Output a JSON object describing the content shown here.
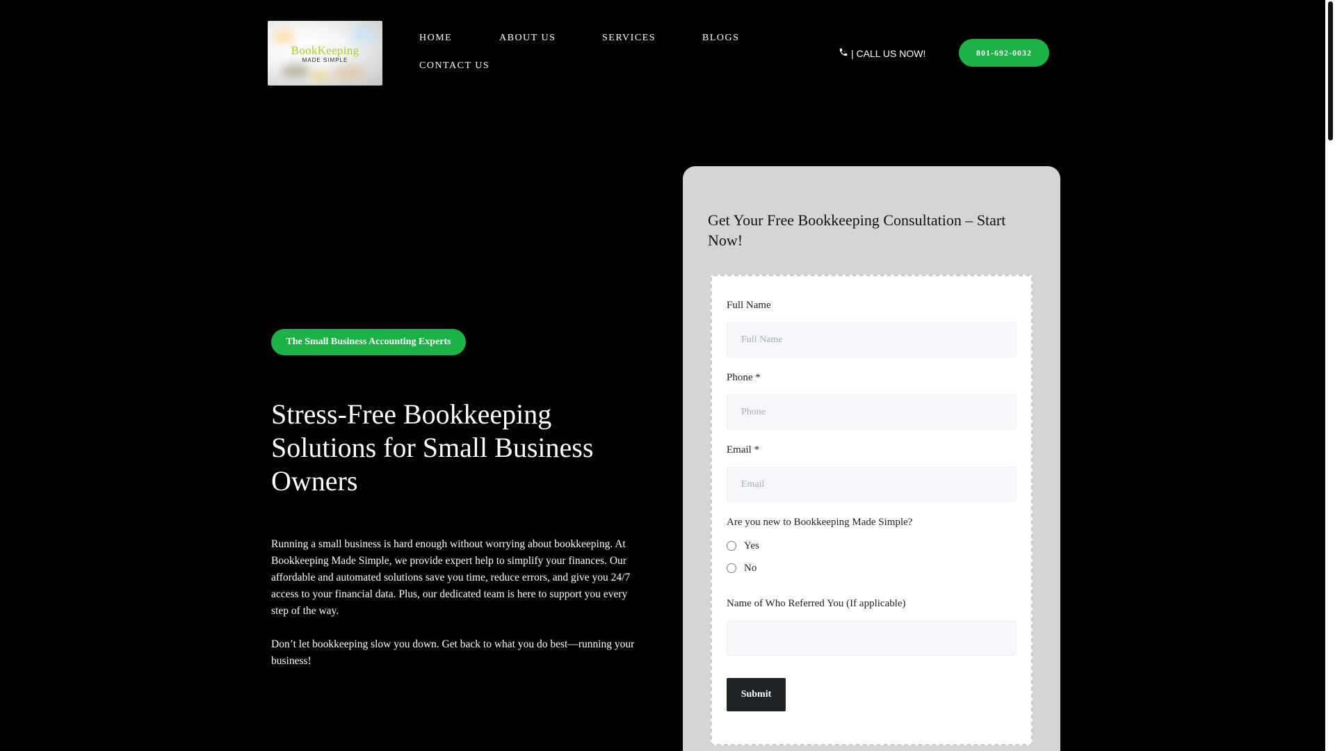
{
  "header": {
    "logo": {
      "title": "BookKeeping",
      "subtitle": "MADE SIMPLE"
    },
    "nav": {
      "home": "HOME",
      "about": "ABOUT US",
      "services": "SERVICES",
      "blogs": "BLOGS",
      "contact": "CONTACT US"
    },
    "call_text": "| CALL US NOW!",
    "phone_button": "801-692-0032"
  },
  "hero": {
    "badge": "The Small Business Accounting Experts",
    "title": "Stress-Free Bookkeeping Solutions for Small Business Owners",
    "paragraph1": "Running a small business is hard enough without worrying about bookkeeping. At Bookkeeping Made Simple, we provide expert help to simplify your finances. Our affordable and automated solutions save you time, reduce errors, and give you 24/7 access to your financial data. Plus, our dedicated team is here to support you every step of the way.",
    "paragraph2": "Don’t let bookkeeping slow you down. Get back to what you do best—running your business!"
  },
  "form": {
    "title": "Get Your Free Bookkeeping Consultation – Start Now!",
    "full_name": {
      "label": "Full Name",
      "placeholder": "Full Name",
      "value": ""
    },
    "phone": {
      "label": "Phone *",
      "placeholder": "Phone",
      "value": ""
    },
    "email": {
      "label": "Email *",
      "placeholder": "Email",
      "value": ""
    },
    "question": "Are you new to Bookkeeping Made Simple?",
    "options": [
      "Yes",
      "No"
    ],
    "referral": {
      "label": "Name of Who Referred You (If applicable)",
      "placeholder": "",
      "value": ""
    },
    "submit": "Submit"
  },
  "colors": {
    "accent_green": "#1db247",
    "background": "#000000",
    "card": "#d5d5d5",
    "submit_button": "#1e2327"
  },
  "icons": {
    "call": "phone-icon"
  }
}
